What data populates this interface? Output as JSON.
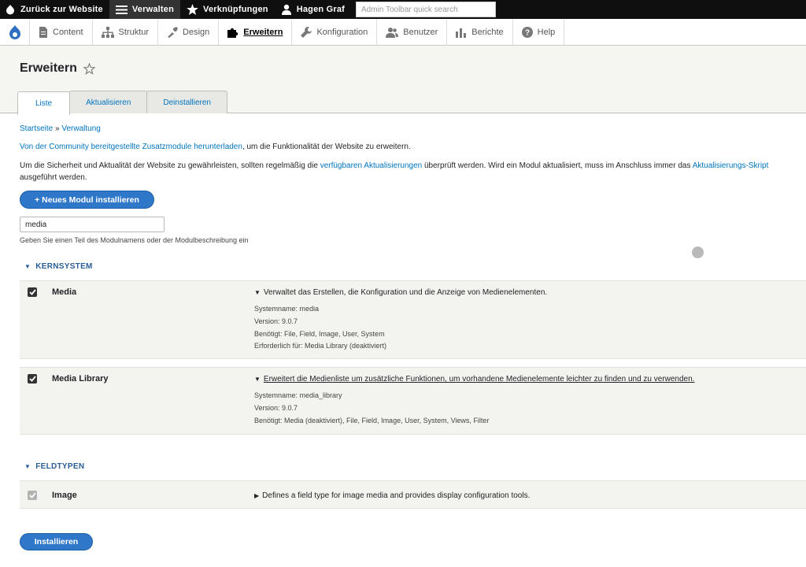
{
  "toolbar": {
    "back_label": "Zurück zur Website",
    "manage_label": "Verwalten",
    "shortcuts_label": "Verknüpfungen",
    "user_label": "Hagen Graf",
    "search_placeholder": "Admin Toolbar quick search"
  },
  "tray": {
    "items": [
      {
        "label": "Content",
        "icon": "content-icon"
      },
      {
        "label": "Struktur",
        "icon": "structure-icon"
      },
      {
        "label": "Design",
        "icon": "appearance-icon"
      },
      {
        "label": "Erweitern",
        "icon": "extend-icon",
        "active": true
      },
      {
        "label": "Konfiguration",
        "icon": "wrench-icon"
      },
      {
        "label": "Benutzer",
        "icon": "people-icon"
      },
      {
        "label": "Berichte",
        "icon": "reports-icon"
      },
      {
        "label": "Help",
        "icon": "help-icon"
      }
    ]
  },
  "page": {
    "title": "Erweitern",
    "tabs": [
      {
        "label": "Liste",
        "active": true
      },
      {
        "label": "Aktualisieren"
      },
      {
        "label": "Deinstallieren"
      }
    ]
  },
  "breadcrumb": {
    "home": "Startseite",
    "sep": "»",
    "admin": "Verwaltung"
  },
  "intro": {
    "link1": "Von der Community bereitgestellte Zusatzmodule herunterladen",
    "text1": ", um die Funktionalität der Website zu erweitern.",
    "text2a": "Um die Sicherheit und Aktualität der Website zu gewährleisten, sollten regelmäßig die ",
    "link2": "verfügbaren Aktualisierungen",
    "text2b": " überprüft werden. Wird ein Modul aktualisiert, muss im Anschluss immer das ",
    "link3": "Aktualisierungs-Skript",
    "text2c": " ausgeführt werden."
  },
  "new_module_button": "+ Neues Modul installieren",
  "filter": {
    "value": "media",
    "description": "Geben Sie einen Teil des Modulnamens oder der Modulbeschreibung ein"
  },
  "groups": {
    "core": {
      "title": "KERNSYSTEM",
      "modules": [
        {
          "name": "Media",
          "description": "Verwaltet das Erstellen, die Konfiguration und die Anzeige von Medienelementen.",
          "machine_name": "Systemname: media",
          "version": "Version: 9.0.7",
          "requires": "Benötigt: File, Field, Image, User, System",
          "required_by": "Erforderlich für: Media Library (deaktiviert)"
        },
        {
          "name": "Media Library",
          "description": "Erweitert die Medienliste um zusätzliche Funktionen, um vorhandene Medienelemente leichter zu finden und zu verwenden.",
          "machine_name": "Systemname: media_library",
          "version": "Version: 9.0.7",
          "requires": "Benötigt: Media (deaktiviert), File, Field, Image, User, System, Views, Filter"
        }
      ]
    },
    "field_types": {
      "title": "FELDTYPEN",
      "modules": [
        {
          "name": "Image",
          "description": "Defines a field type for image media and provides display configuration tools."
        }
      ]
    }
  },
  "install_button": "Installieren"
}
